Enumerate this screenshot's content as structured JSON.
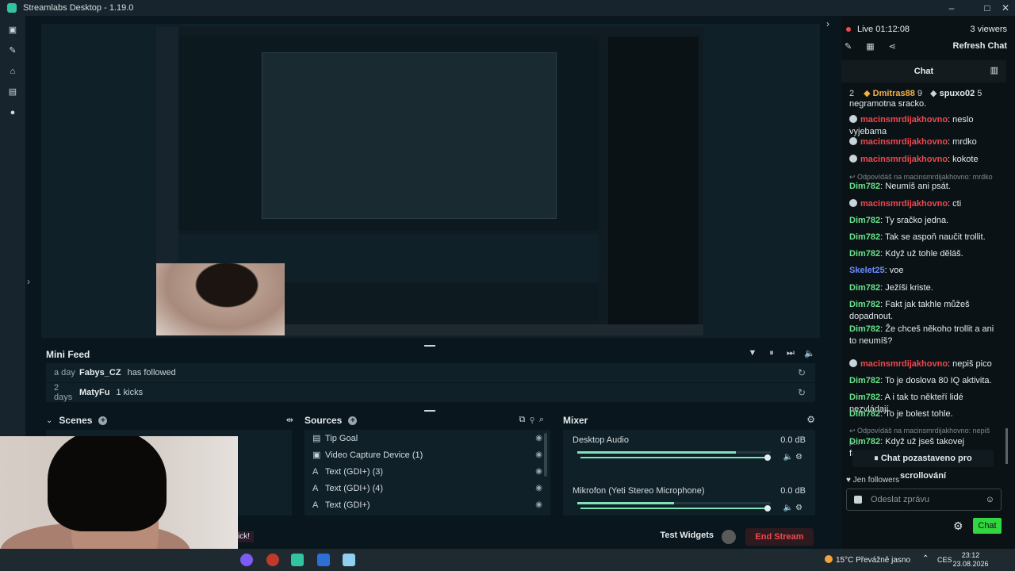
{
  "titlebar": {
    "title": "Streamlabs Desktop - 1.19.0"
  },
  "chat": {
    "live_label": "Live 01:12:08",
    "viewers": "3 viewers",
    "refresh_label": "Refresh Chat",
    "header": "Chat",
    "leaderboard": [
      {
        "rank": "2",
        "name": "Dmitras88",
        "count": "9"
      },
      {
        "name": "spuxo02",
        "count": "5"
      }
    ],
    "messages": [
      {
        "text": "negramotna sracko."
      },
      {
        "name": "macinsmrdijakhovno",
        "text": "neslo vyjebama",
        "color": "red",
        "mod": true
      },
      {
        "name": "macinsmrdijakhovno",
        "text": "mrdko",
        "color": "red",
        "mod": true
      },
      {
        "name": "macinsmrdijakhovno",
        "text": "kokote",
        "color": "red",
        "mod": true
      },
      {
        "reply": "Odpovídáš na macinsmrdijakhovno: mrdko"
      },
      {
        "name": "Dim782",
        "text": "Neumíš ani psát.",
        "color": "green"
      },
      {
        "name": "macinsmrdijakhovno",
        "text": "cti",
        "color": "red",
        "mod": true
      },
      {
        "name": "Dim782",
        "text": "Ty sračko jedna.",
        "color": "green"
      },
      {
        "name": "Dim782",
        "text": "Tak se aspoň naučit trollit.",
        "color": "green"
      },
      {
        "name": "Dim782",
        "text": "Když už tohle děláš.",
        "color": "green"
      },
      {
        "name": "Skelet25",
        "text": "voe",
        "color": "blue"
      },
      {
        "name": "Dim782",
        "text": "Ježíši kriste.",
        "color": "green"
      },
      {
        "name": "Dim782",
        "text": "Fakt jak takhle můžeš dopadnout.",
        "color": "green"
      },
      {
        "name": "Dim782",
        "text": "Že chceš někoho trollit a ani to neumíš?",
        "color": "green"
      },
      {
        "name": "macinsmrdijakhovno",
        "text": "nepiš pico",
        "color": "red",
        "mod": true
      },
      {
        "name": "Dim782",
        "text": "To je doslova 80 IQ aktivita.",
        "color": "green"
      },
      {
        "name": "Dim782",
        "text": "A i tak to někteří lidé nezvládají.",
        "color": "green"
      },
      {
        "name": "Dim782",
        "text": "To je bolest tohle.",
        "color": "green"
      },
      {
        "reply": "Odpovídáš na macinsmrdijakhovno: nepiš p..."
      },
      {
        "name": "Dim782",
        "text": "Když už jseš takovej fanoušek",
        "color": "green"
      }
    ],
    "paused_label": "Chat pozastaveno pro scrollování",
    "follow_filter": "Jen followers",
    "input_placeholder": "Odeslat zprávu",
    "send_label": "Chat"
  },
  "minifeed": {
    "title": "Mini Feed",
    "rows": [
      {
        "ago": "a day",
        "name": "Fabys_CZ",
        "action": "has followed"
      },
      {
        "ago": "2 days",
        "name": "MatyFu",
        "action": "1 kicks"
      }
    ]
  },
  "scenes": {
    "title": "Scenes"
  },
  "sources": {
    "title": "Sources",
    "items": [
      {
        "label": "Tip Goal",
        "icon": "goal-icon"
      },
      {
        "label": "Video Capture Device (1)",
        "icon": "camera-icon"
      },
      {
        "label": "Text (GDI+) (3)",
        "icon": "text-icon"
      },
      {
        "label": "Text (GDI+) (4)",
        "icon": "text-icon"
      },
      {
        "label": "Text (GDI+)",
        "icon": "text-icon"
      }
    ]
  },
  "mixer": {
    "title": "Mixer",
    "channels": [
      {
        "name": "Desktop Audio",
        "db": "0.0 dB",
        "level": 0.82
      },
      {
        "name": "Mikrofon (Yeti Stereo Microphone)",
        "db": "0.0 dB",
        "level": 0.5
      }
    ]
  },
  "bottom": {
    "test_widgets": "Test Widgets",
    "end_stream": "End Stream",
    "kick": "ick!"
  },
  "taskbar": {
    "weather": "15°C Převážně jasno",
    "lang": "CES",
    "time": "23:12",
    "date": "23.08.2026"
  },
  "colors": {
    "accent": "#31c3a2",
    "live": "#f0484f",
    "chat_btn": "#31d640"
  }
}
